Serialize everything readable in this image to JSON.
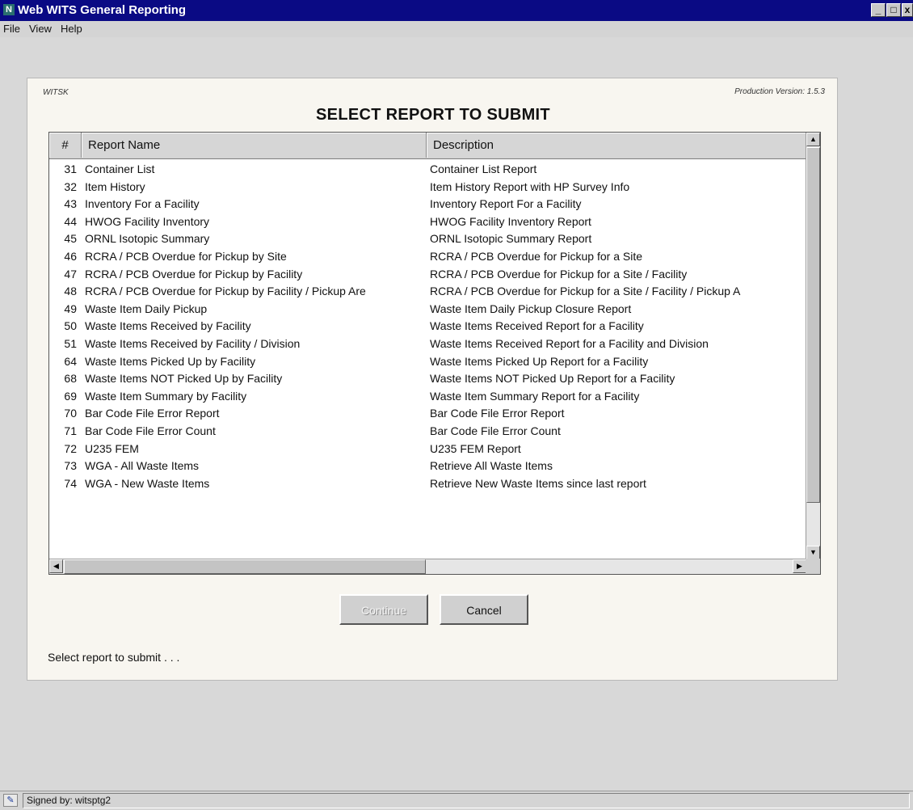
{
  "window": {
    "title": "Web WITS General Reporting",
    "app_icon": "N",
    "controls": {
      "minimize": "_",
      "maximize": "□",
      "close": "x"
    }
  },
  "menu": [
    "File",
    "View",
    "Help"
  ],
  "panel": {
    "app_code": "WITSK",
    "version": "Production Version: 1.5.3",
    "heading": "SELECT REPORT TO SUBMIT"
  },
  "table": {
    "columns": [
      "#",
      "Report Name",
      "Description"
    ],
    "rows": [
      {
        "num": "31",
        "name": "Container List",
        "desc": "Container List Report"
      },
      {
        "num": "32",
        "name": "Item History",
        "desc": "Item History Report with HP Survey Info"
      },
      {
        "num": "43",
        "name": "Inventory For a Facility",
        "desc": "Inventory Report For a Facility"
      },
      {
        "num": "44",
        "name": "HWOG Facility Inventory",
        "desc": "HWOG Facility Inventory Report"
      },
      {
        "num": "45",
        "name": "ORNL Isotopic Summary",
        "desc": "ORNL Isotopic Summary Report"
      },
      {
        "num": "46",
        "name": "RCRA / PCB Overdue for Pickup by Site",
        "desc": "RCRA / PCB Overdue for Pickup for a Site"
      },
      {
        "num": "47",
        "name": "RCRA / PCB Overdue for Pickup by Facility",
        "desc": "RCRA / PCB Overdue for Pickup for a Site / Facility"
      },
      {
        "num": "48",
        "name": "RCRA / PCB Overdue for Pickup by Facility / Pickup Are",
        "desc": "RCRA / PCB Overdue for Pickup for a Site / Facility / Pickup A"
      },
      {
        "num": "49",
        "name": "Waste Item Daily Pickup",
        "desc": "Waste Item Daily Pickup Closure Report"
      },
      {
        "num": "50",
        "name": "Waste Items Received by Facility",
        "desc": "Waste Items Received Report for a Facility"
      },
      {
        "num": "51",
        "name": "Waste Items Received by Facility / Division",
        "desc": "Waste Items Received Report for a Facility and Division"
      },
      {
        "num": "64",
        "name": "Waste Items Picked Up by Facility",
        "desc": "Waste Items Picked Up Report for a Facility"
      },
      {
        "num": "68",
        "name": "Waste Items NOT Picked Up by Facility",
        "desc": "Waste Items NOT Picked Up Report for a Facility"
      },
      {
        "num": "69",
        "name": "Waste Item Summary by Facility",
        "desc": "Waste Item Summary Report for a Facility"
      },
      {
        "num": "70",
        "name": "Bar Code File Error Report",
        "desc": "Bar Code File Error Report"
      },
      {
        "num": "71",
        "name": "Bar Code File Error Count",
        "desc": "Bar Code File Error Count"
      },
      {
        "num": "72",
        "name": "U235 FEM",
        "desc": "U235 FEM Report"
      },
      {
        "num": "73",
        "name": "WGA - All Waste Items",
        "desc": "Retrieve All Waste Items"
      },
      {
        "num": "74",
        "name": "WGA - New Waste Items",
        "desc": "Retrieve New Waste Items since last report"
      }
    ]
  },
  "buttons": {
    "continue": "Continue",
    "cancel": "Cancel"
  },
  "status_message": "Select report to submit . . .",
  "statusbar": {
    "signed_by": "Signed by: witsptg2"
  },
  "colors": {
    "titlebar": "#0a0a84",
    "panel_bg": "#f8f6f0",
    "window_bg": "#d8d8d8"
  }
}
